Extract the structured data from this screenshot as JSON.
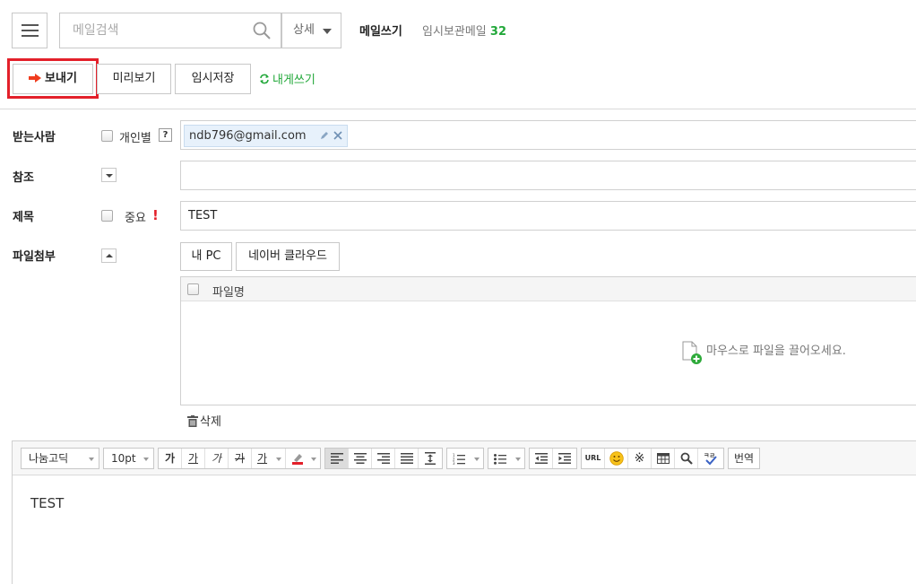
{
  "header": {
    "search_placeholder": "메일검색",
    "detail_label": "상세",
    "compose_label": "메일쓰기",
    "drafts_label": "임시보관메일",
    "drafts_count": "32"
  },
  "actions": {
    "send_label": "보내기",
    "preview_label": "미리보기",
    "save_draft_label": "임시저장",
    "send_to_self_label": "내게쓰기"
  },
  "form": {
    "to_label": "받는사람",
    "individual_label": "개인별",
    "help_glyph": "?",
    "recipients": [
      "ndb796@gmail.com"
    ],
    "cc_label": "참조",
    "subject_label": "제목",
    "important_label": "중요",
    "important_mark": "!",
    "subject_value": "TEST",
    "attach_label": "파일첨부",
    "my_pc_label": "내 PC",
    "cloud_label": "네이버 클라우드",
    "file_column_label": "파일명",
    "drop_hint": "마우스로 파일을 끌어오세요.",
    "delete_label": "삭제"
  },
  "editor": {
    "font_family": "나눔고딕",
    "font_size": "10pt",
    "bold": "가",
    "underline": "가",
    "italic": "가",
    "strike": "가",
    "font_color": "가",
    "url_label": "URL",
    "translate_label": "번역",
    "body_text": "TEST"
  },
  "colors": {
    "accent_green": "#22a83a",
    "highlight_red": "#e3202a",
    "send_arrow": "#f03c1e"
  }
}
